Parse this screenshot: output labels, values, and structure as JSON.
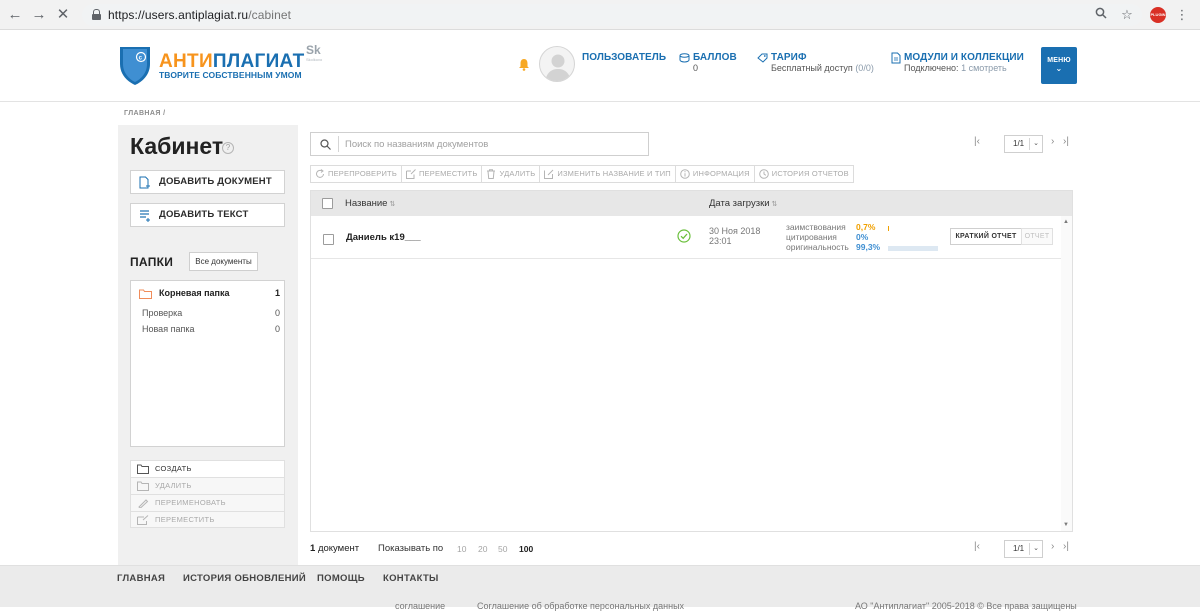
{
  "browser": {
    "url_host": "https://users.antiplagiat.ru",
    "url_path": "/cabinet",
    "ext_badge": "PLUGIN"
  },
  "header": {
    "logo_part1": "АНТИ",
    "logo_part2": "ПЛАГИАТ",
    "slogan": "ТВОРИТЕ СОБСТВЕННЫМ УМОМ",
    "sk_logo": "Sk",
    "sk_sub": "Skolkovo",
    "user_label": "ПОЛЬЗОВАТЕЛЬ",
    "points_label": "БАЛЛОВ",
    "points_value": "0",
    "tariff_label": "ТАРИФ",
    "tariff_value": "Бесплатный доступ",
    "tariff_count": "(0/0)",
    "modules_label": "МОДУЛИ И КОЛЛЕКЦИИ",
    "modules_connected": "Подключено:",
    "modules_link": "1 смотреть",
    "menu_label": "МЕНЮ"
  },
  "breadcrumb": "ГЛАВНАЯ  /",
  "sidebar": {
    "page_title": "Кабинет",
    "add_document": "ДОБАВИТЬ ДОКУМЕНТ",
    "add_text": "ДОБАВИТЬ ТЕКСТ",
    "folders_title": "ПАПКИ",
    "all_docs": "Все документы",
    "folders": [
      {
        "label": "Корневая папка",
        "count": "1"
      },
      {
        "label": "Проверка",
        "count": "0"
      },
      {
        "label": "Новая папка",
        "count": "0"
      }
    ],
    "actions": [
      "СОЗДАТЬ",
      "УДАЛИТЬ",
      "ПЕРЕИМЕНОВАТЬ",
      "ПЕРЕМЕСТИТЬ"
    ]
  },
  "search": {
    "placeholder": "Поиск по названиям документов"
  },
  "pager": {
    "page": "1/1"
  },
  "toolbar": [
    "ПЕРЕПРОВЕРИТЬ",
    "ПЕРЕМЕСТИТЬ",
    "УДАЛИТЬ",
    "ИЗМЕНИТЬ НАЗВАНИЕ И ТИП",
    "ИНФОРМАЦИЯ",
    "ИСТОРИЯ ОТЧЕТОВ"
  ],
  "table": {
    "col_name": "Название",
    "col_date": "Дата загрузки",
    "rows": [
      {
        "name": "Даниель к19___",
        "date_line1": "30 Ноя 2018",
        "date_line2": "23:01",
        "borrow_label": "заимствования",
        "borrow_value": "0,7%",
        "borrow_color": "#f0a000",
        "cite_label": "цитирования",
        "cite_value": "0%",
        "cite_color": "#3f8fd2",
        "orig_label": "оригинальность",
        "orig_value": "99,3%",
        "orig_color": "#3f8fd2",
        "short_report": "КРАТКИЙ ОТЧЕТ",
        "report": "ОТЧЕТ"
      }
    ]
  },
  "bottom": {
    "doc_count_num": "1",
    "doc_count_word": "документ",
    "show_label": "Показывать по",
    "page_sizes": [
      "10",
      "20",
      "50",
      "100"
    ],
    "selected_size": "100"
  },
  "footer": {
    "links": [
      "ГЛАВНАЯ",
      "ИСТОРИЯ ОБНОВЛЕНИЙ",
      "ПОМОЩЬ",
      "КОНТАКТЫ"
    ],
    "agreement": "соглашение",
    "personal_data": "Соглашение об обработке персональных данных",
    "copyright": "АО \"Антиплагиат\" 2005-2018 © Все права защищены"
  }
}
